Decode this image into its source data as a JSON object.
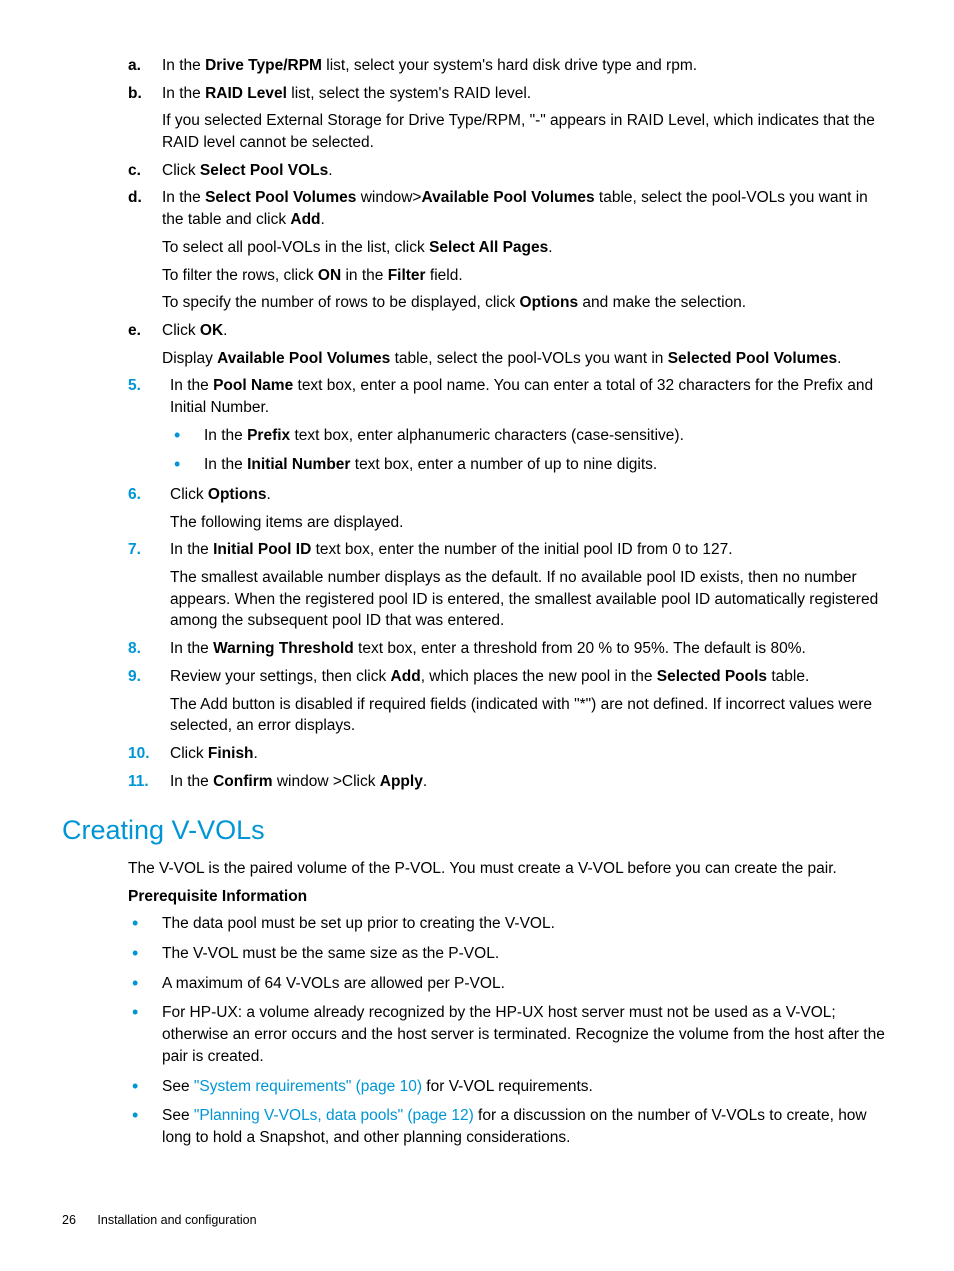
{
  "alpha": {
    "a": {
      "marker": "a.",
      "pre": "In the ",
      "b1": "Drive Type/RPM",
      "post": " list, select your system's hard disk drive type and rpm."
    },
    "b": {
      "marker": "b.",
      "pre": "In the ",
      "b1": "RAID Level",
      "post": " list, select the system's RAID level.",
      "p1": "If you selected External Storage for Drive Type/RPM, \"-\" appears in RAID Level, which indicates that the RAID level cannot be selected."
    },
    "c": {
      "marker": "c.",
      "pre": "Click ",
      "b1": "Select Pool VOLs",
      "post": "."
    },
    "d": {
      "marker": "d.",
      "pre": "In the ",
      "b1": "Select Pool Volumes",
      "mid1": " window>",
      "b2": "Available Pool Volumes",
      "mid2": " table, select the pool-VOLs you want in the table and click ",
      "b3": "Add",
      "post": ".",
      "p1_pre": "To select all pool-VOLs in the list, click ",
      "p1_b": "Select All Pages",
      "p1_post": ".",
      "p2_pre": "To filter the rows, click ",
      "p2_b1": "ON",
      "p2_mid": " in the ",
      "p2_b2": "Filter",
      "p2_post": " field.",
      "p3_pre": "To specify the number of rows to be displayed, click ",
      "p3_b": "Options",
      "p3_post": " and make the selection."
    },
    "e": {
      "marker": "e.",
      "pre": "Click ",
      "b1": "OK",
      "post": ".",
      "p1_pre": "Display ",
      "p1_b1": "Available Pool Volumes",
      "p1_mid": " table, select the pool-VOLs you want in ",
      "p1_b2": "Selected Pool Volumes",
      "p1_post": "."
    }
  },
  "num": {
    "s5": {
      "marker": "5.",
      "pre": "In the ",
      "b1": "Pool Name",
      "post": " text box, enter a pool name. You can enter a total of 32 characters for the Prefix and Initial Number.",
      "bul1_pre": "In the ",
      "bul1_b": "Prefix",
      "bul1_post": " text box, enter alphanumeric characters (case-sensitive).",
      "bul2_pre": "In the ",
      "bul2_b": "Initial Number",
      "bul2_post": " text box, enter a number of up to nine digits."
    },
    "s6": {
      "marker": "6.",
      "pre": "Click ",
      "b1": "Options",
      "post": ".",
      "p1": "The following items are displayed."
    },
    "s7": {
      "marker": "7.",
      "pre": "In the ",
      "b1": "Initial Pool ID",
      "post": " text box, enter the number of the initial pool ID from 0 to 127.",
      "p1": "The smallest available number displays as the default. If no available pool ID exists, then no number appears. When the registered pool ID is entered, the smallest available pool ID automatically registered among the subsequent pool ID that was entered."
    },
    "s8": {
      "marker": "8.",
      "pre": "In the ",
      "b1": "Warning Threshold",
      "post": " text box, enter a threshold from 20 % to 95%. The default is 80%."
    },
    "s9": {
      "marker": "9.",
      "pre": "Review your settings, then click ",
      "b1": "Add",
      "mid": ", which places the new pool in the ",
      "b2": "Selected Pools",
      "post": " table.",
      "p1": "The Add button is disabled if required fields (indicated with \"*\") are not defined. If incorrect values were selected, an error displays."
    },
    "s10": {
      "marker": "10.",
      "pre": "Click ",
      "b1": "Finish",
      "post": "."
    },
    "s11": {
      "marker": "11.",
      "pre": "In the ",
      "b1": "Confirm",
      "mid": " window >Click ",
      "b2": "Apply",
      "post": "."
    }
  },
  "section": {
    "h2": "Creating V-VOLs",
    "intro": "The V-VOL is the paired volume of the P-VOL. You must create a V-VOL before you can create the pair.",
    "prereq_heading": "Prerequisite Information",
    "bul1": "The data pool must be set up prior to creating the V-VOL.",
    "bul2": "The V-VOL must be the same size as the P-VOL.",
    "bul3": "A maximum of 64 V-VOLs are allowed per P-VOL.",
    "bul4": "For HP-UX: a volume already recognized by the HP-UX host server must not be used as a V-VOL; otherwise an error occurs and the host server is terminated. Recognize the volume from the host after the pair is created.",
    "bul5_pre": "See ",
    "bul5_link": "\"System requirements\" (page 10)",
    "bul5_post": " for V-VOL requirements.",
    "bul6_pre": "See ",
    "bul6_link": "\"Planning V-VOLs, data pools\" (page 12)",
    "bul6_post": " for a discussion on the number of V-VOLs to create, how long to hold a Snapshot, and other planning considerations."
  },
  "footer": {
    "page": "26",
    "title": "Installation and configuration"
  }
}
